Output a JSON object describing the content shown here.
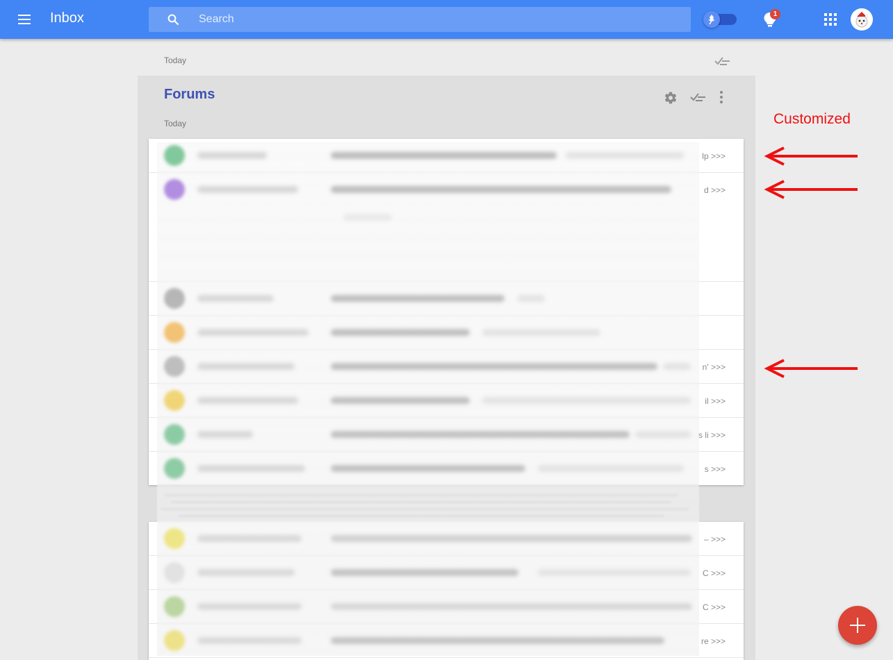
{
  "app": {
    "title": "Inbox"
  },
  "search": {
    "placeholder": "Search"
  },
  "notifications": {
    "count": "1"
  },
  "inbox": {
    "day_label": "Today"
  },
  "cluster": {
    "title": "Forums",
    "day_label": "Today",
    "rows": [
      {
        "avatar_color": "#3fb06a",
        "tail": "lp >>>"
      },
      {
        "avatar_color": "#8a4fd6",
        "tail": "d >>>"
      },
      {
        "avatar_color": "#8f8f8f",
        "tail": ""
      },
      {
        "avatar_color": "#f4a21c",
        "tail": ""
      },
      {
        "avatar_color": "#9a9a9a",
        "tail": "n' >>>"
      },
      {
        "avatar_color": "#f2c21a",
        "tail": "il >>>"
      },
      {
        "avatar_color": "#3fb06a",
        "tail": "s li >>>"
      },
      {
        "avatar_color": "#3fb06a",
        "tail": "s >>>"
      }
    ],
    "rows2": [
      {
        "avatar_color": "#eede2a",
        "tail": "– >>>"
      },
      {
        "avatar_color": "#d8d8d8",
        "tail": "C >>>"
      },
      {
        "avatar_color": "#8cc05a",
        "tail": "C >>>"
      },
      {
        "avatar_color": "#eed82a",
        "tail": "re >>>"
      }
    ]
  },
  "annotation": {
    "label": "Customized",
    "color": "#ee1111"
  },
  "colors": {
    "topbar": "#4285f4",
    "fab": "#db4437",
    "cluster_title": "#3f51b5"
  },
  "icons": [
    "menu-icon",
    "search-icon",
    "pin-icon",
    "bulb-icon",
    "apps-icon",
    "sweep-icon",
    "gear-icon",
    "more-vert-icon",
    "add-icon"
  ]
}
